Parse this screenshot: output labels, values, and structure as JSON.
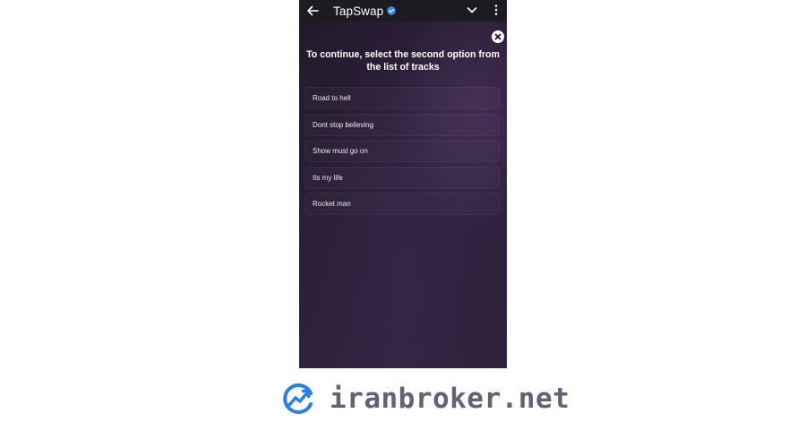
{
  "header": {
    "title": "TapSwap",
    "back_icon": "arrow-left-icon",
    "verified_icon": "verified-badge-icon",
    "chevron_icon": "chevron-down-icon",
    "more_icon": "more-vertical-icon"
  },
  "dialog": {
    "close_icon": "close-icon",
    "prompt": "To continue, select the second option from the list of tracks",
    "options": [
      "Road to hell",
      "Dont stop believing",
      "Show must go on",
      "Its my life",
      "Rocket man"
    ]
  },
  "watermark": {
    "text": "iranbroker.net",
    "logo_icon": "growth-chart-logo",
    "colors": {
      "logo_blue": "#2f7fe0",
      "text_gray": "#5f6470"
    }
  },
  "colors": {
    "background_dark": "#241c2f",
    "accent_purple": "#5c3a6e",
    "verified_blue": "#3a8ee6"
  }
}
